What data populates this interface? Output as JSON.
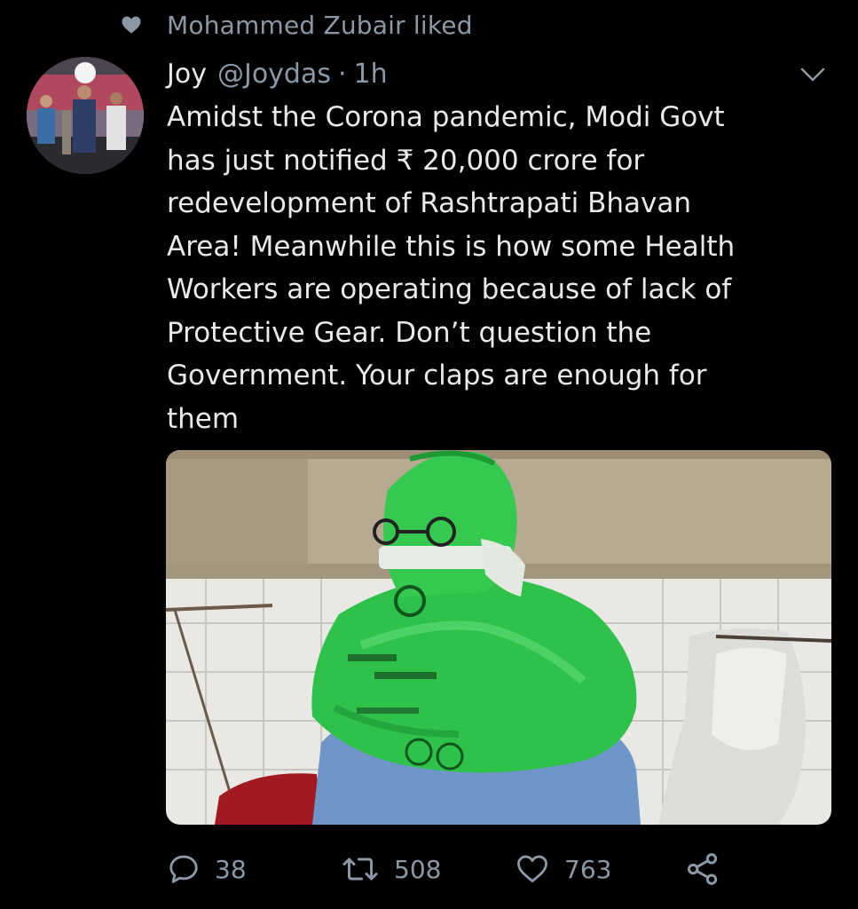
{
  "social_context": {
    "icon": "heart-filled-icon",
    "text": "Mohammed Zubair liked"
  },
  "tweet": {
    "author": {
      "display_name": "Joy",
      "handle": "@Joydas",
      "avatar": "avatar-photo"
    },
    "separator": "·",
    "time": "1h",
    "menu_icon": "chevron-down-icon",
    "text": "Amidst the Corona pandemic, Modi Govt\nhas just notified ₹ 20,000 crore for\nredevelopment of Rashtrapati Bhavan\nArea! Meanwhile this is how some Health\nWorkers are operating because of lack of\nProtective Gear. Don’t question the\nGovernment. Your claps are enough for\nthem",
    "media": {
      "type": "photo"
    },
    "actions": {
      "reply": {
        "icon": "reply-icon",
        "count": "38"
      },
      "retweet": {
        "icon": "retweet-icon",
        "count": "508"
      },
      "like": {
        "icon": "heart-outline-icon",
        "count": "763"
      },
      "share": {
        "icon": "share-icon"
      }
    }
  },
  "colors": {
    "background": "#000000",
    "primary_text": "#e7e9ea",
    "secondary_text": "#8b98a5",
    "bag_green": "#2fc24a"
  }
}
